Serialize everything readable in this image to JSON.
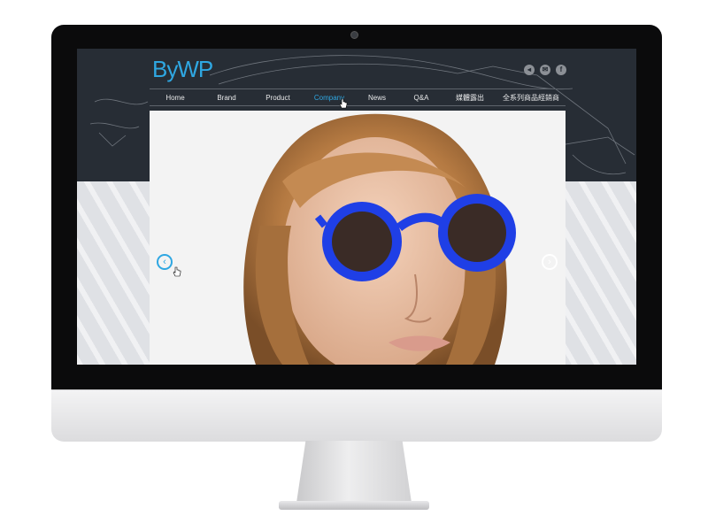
{
  "site": {
    "logo": "ByWP",
    "nav": [
      {
        "label": "Home"
      },
      {
        "label": "Brand"
      },
      {
        "label": "Product"
      },
      {
        "label": "Company"
      },
      {
        "label": "News"
      },
      {
        "label": "Q&A"
      },
      {
        "label": "媒體露出"
      },
      {
        "label": "全系列商品經銷商"
      }
    ],
    "active_nav": "Company",
    "social_icons": [
      "sound-icon",
      "mail-icon",
      "facebook-icon"
    ],
    "hero": {
      "prev_symbol": "‹",
      "next_symbol": "›"
    }
  },
  "colors": {
    "accent": "#2fa7e2",
    "header_bg": "#272d35",
    "glasses": "#1f3fe6"
  }
}
